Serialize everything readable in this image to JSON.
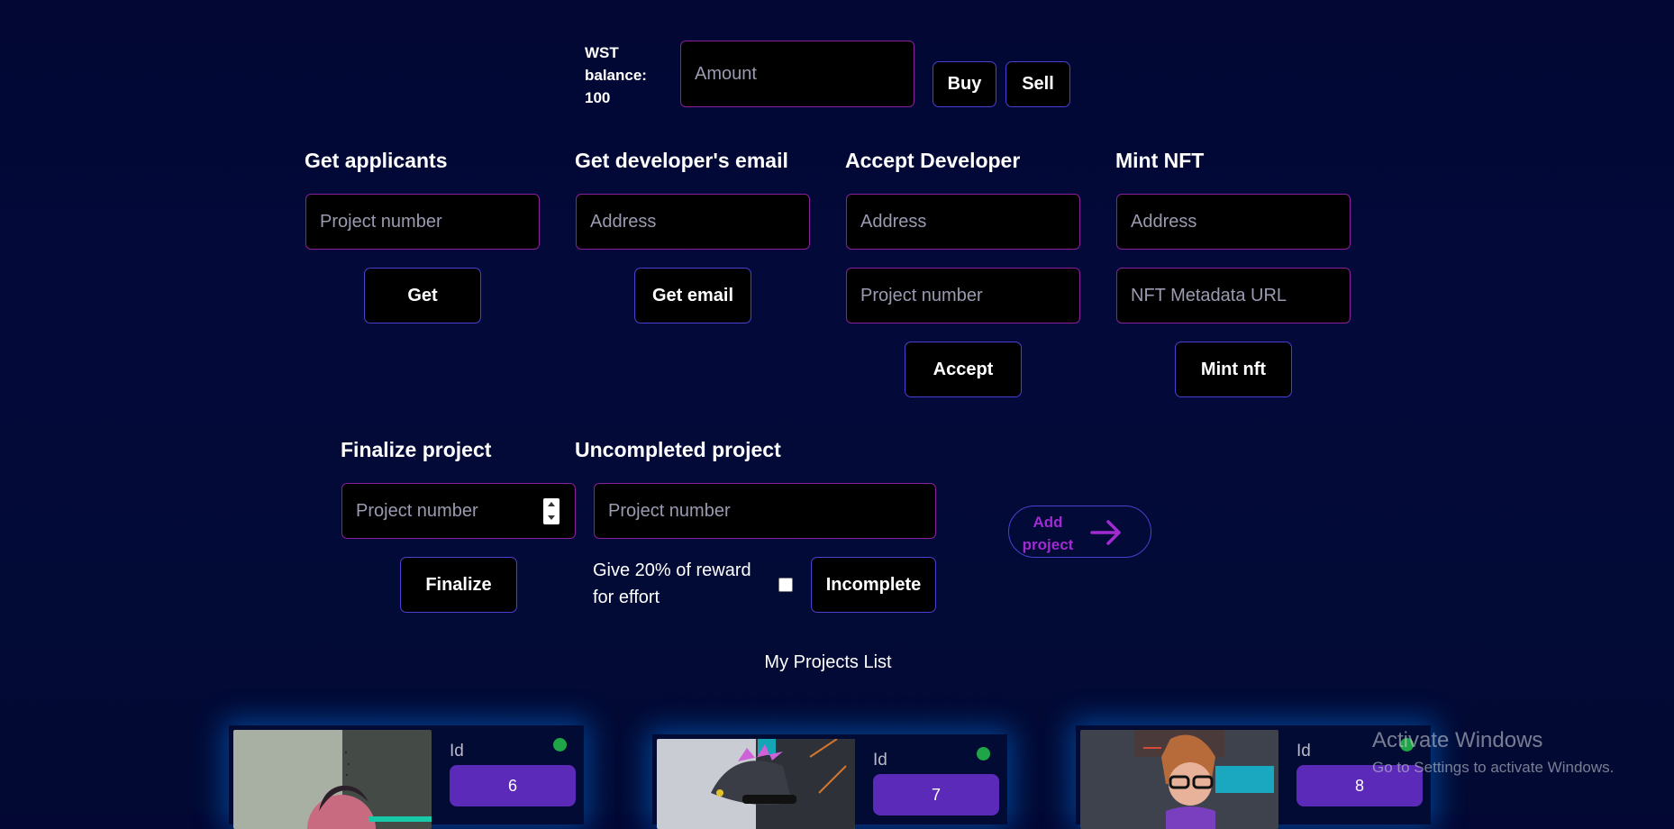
{
  "balance": {
    "label": "WST balance:",
    "value": "100",
    "amount_placeholder": "Amount",
    "buy_label": "Buy",
    "sell_label": "Sell"
  },
  "get_applicants": {
    "title": "Get applicants",
    "input_placeholder": "Project number",
    "button_label": "Get"
  },
  "get_email": {
    "title": "Get developer's email",
    "input_placeholder": "Address",
    "button_label": "Get email"
  },
  "accept_developer": {
    "title": "Accept Developer",
    "address_placeholder": "Address",
    "project_placeholder": "Project number",
    "button_label": "Accept"
  },
  "mint_nft": {
    "title": "Mint NFT",
    "address_placeholder": "Address",
    "url_placeholder": "NFT Metadata URL",
    "button_label": "Mint nft"
  },
  "finalize": {
    "title": "Finalize project",
    "input_placeholder": "Project number",
    "button_label": "Finalize"
  },
  "uncompleted": {
    "title": "Uncompleted project",
    "input_placeholder": "Project number",
    "checkbox_label": "Give 20% of reward for effort",
    "button_label": "Incomplete"
  },
  "add_project": {
    "label": "Add project"
  },
  "projects": {
    "title": "My Projects List",
    "items": [
      {
        "id_label": "Id",
        "id": "6"
      },
      {
        "id_label": "Id",
        "id": "7"
      },
      {
        "id_label": "Id",
        "id": "8"
      }
    ]
  },
  "watermark": {
    "title": "Activate Windows",
    "subtitle": "Go to Settings to activate Windows."
  },
  "colors": {
    "background": "#020733",
    "input_border": "#8a1f9c",
    "button_border": "#4b3fd1",
    "pill": "#5b2ab8",
    "status_dot": "#1fa447",
    "accent": "#a12ad1"
  }
}
